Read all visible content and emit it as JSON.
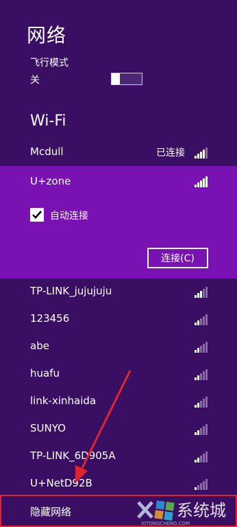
{
  "panel": {
    "title": "网络"
  },
  "airplane": {
    "label": "飞行模式",
    "state": "关"
  },
  "wifi": {
    "heading": "Wi-Fi",
    "connected": {
      "name": "Mcdull",
      "status": "已连接",
      "signal": 4
    },
    "selected": {
      "name": "U+zone",
      "signal": 5,
      "auto_connect_label": "自动连接",
      "auto_connect_checked": true,
      "connect_button": "连接(C)"
    },
    "networks": [
      {
        "name": "TP-LINK_jujujuju",
        "signal": 3
      },
      {
        "name": "123456",
        "signal": 2
      },
      {
        "name": "abe",
        "signal": 2
      },
      {
        "name": "huafu",
        "signal": 2
      },
      {
        "name": "link-xinhaida",
        "signal": 2
      },
      {
        "name": "SUNYO",
        "signal": 2
      },
      {
        "name": "TP-LINK_6D905A",
        "signal": 2
      },
      {
        "name": "U+NetD92B",
        "signal": 1
      }
    ],
    "hidden": {
      "name": "隐藏网络"
    }
  },
  "colors": {
    "background": "#3a0f63",
    "selected": "#7a12b3",
    "highlight_box": "#e0262c",
    "arrow": "#e0262c"
  },
  "watermark": {
    "text": "系统城",
    "subtext": "XITONGCHENG.COM"
  }
}
